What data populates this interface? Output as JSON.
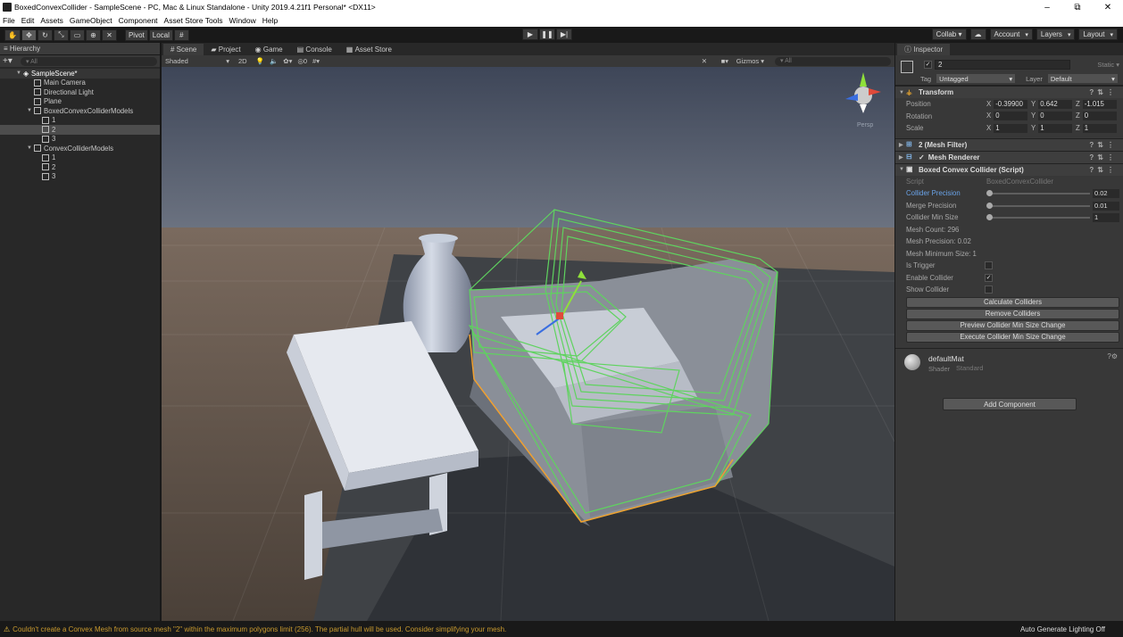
{
  "window": {
    "title": "BoxedConvexCollider - SampleScene - PC, Mac & Linux Standalone - Unity 2019.4.21f1 Personal* <DX11>",
    "minimize": "–",
    "maximize": "⧉",
    "close": "✕"
  },
  "menu": [
    "File",
    "Edit",
    "Assets",
    "GameObject",
    "Component",
    "Asset Store Tools",
    "Window",
    "Help"
  ],
  "toolbar": {
    "pivot": "Pivot",
    "local": "Local",
    "collab": "Collab ▾",
    "account": "Account",
    "layers": "Layers",
    "layout": "Layout"
  },
  "hierarchy": {
    "tab": "Hierarchy",
    "search_placeholder": "▾ All",
    "items": [
      {
        "label": "SampleScene*",
        "depth": 0,
        "type": "scene"
      },
      {
        "label": "Main Camera",
        "depth": 1
      },
      {
        "label": "Directional Light",
        "depth": 1
      },
      {
        "label": "Plane",
        "depth": 1
      },
      {
        "label": "BoxedConvexColliderModels",
        "depth": 1,
        "expanded": true
      },
      {
        "label": "1",
        "depth": 2
      },
      {
        "label": "2",
        "depth": 2,
        "selected": true
      },
      {
        "label": "3",
        "depth": 2
      },
      {
        "label": "ConvexColliderModels",
        "depth": 1,
        "expanded": true
      },
      {
        "label": "1",
        "depth": 2
      },
      {
        "label": "2",
        "depth": 2
      },
      {
        "label": "3",
        "depth": 2
      }
    ]
  },
  "scene": {
    "tabs": [
      "Scene",
      "Project",
      "Game",
      "Console",
      "Asset Store"
    ],
    "shading": "Shaded",
    "mode_2d": "2D",
    "gizmos": "Gizmos",
    "search_placeholder": "▾ All",
    "persp_label": "Persp"
  },
  "inspector": {
    "tab": "Inspector",
    "object_name": "2",
    "static_label": "Static ▾",
    "tag_label": "Tag",
    "tag_value": "Untagged",
    "layer_label": "Layer",
    "layer_value": "Default",
    "transform": {
      "title": "Transform",
      "position_label": "Position",
      "rotation_label": "Rotation",
      "scale_label": "Scale",
      "position": [
        "-0.39900",
        "0.642",
        "-1.015"
      ],
      "rotation": [
        "0",
        "0",
        "0"
      ],
      "scale": [
        "1",
        "1",
        "1"
      ]
    },
    "mesh_filter": "2 (Mesh Filter)",
    "mesh_renderer": "Mesh Renderer",
    "script_component": {
      "title": "Boxed Convex Collider (Script)",
      "script_label": "Script",
      "script_value": "BoxedConvexCollider",
      "collider_precision_label": "Collider Precision",
      "collider_precision": "0.02",
      "merge_precision_label": "Merge Precision",
      "merge_precision": "0.01",
      "collider_min_size_label": "Collider Min Size",
      "collider_min_size": "1",
      "mesh_count": "Mesh Count: 296",
      "mesh_precision": "Mesh Precision: 0.02",
      "mesh_min_size": "Mesh Minimum Size: 1",
      "is_trigger_label": "Is Trigger",
      "enable_collider_label": "Enable Collider",
      "show_collider_label": "Show Collider",
      "buttons": [
        "Calculate Colliders",
        "Remove Colliders",
        "Preview Collider Min Size Change",
        "Execute Collider Min Size Change"
      ]
    },
    "material": {
      "name": "defaultMat",
      "shader_label": "Shader",
      "shader_value": "Standard"
    },
    "add_component": "Add Component"
  },
  "status": {
    "message": "Couldn't create a Convex Mesh from source mesh \"2\" within the maximum polygons limit (256). The partial hull will be used. Consider simplifying your mesh.",
    "right": "Auto Generate Lighting Off"
  },
  "colors": {
    "collider_green": "#5fd35f",
    "selection_orange": "#f0a030",
    "warning": "#f0c040"
  }
}
